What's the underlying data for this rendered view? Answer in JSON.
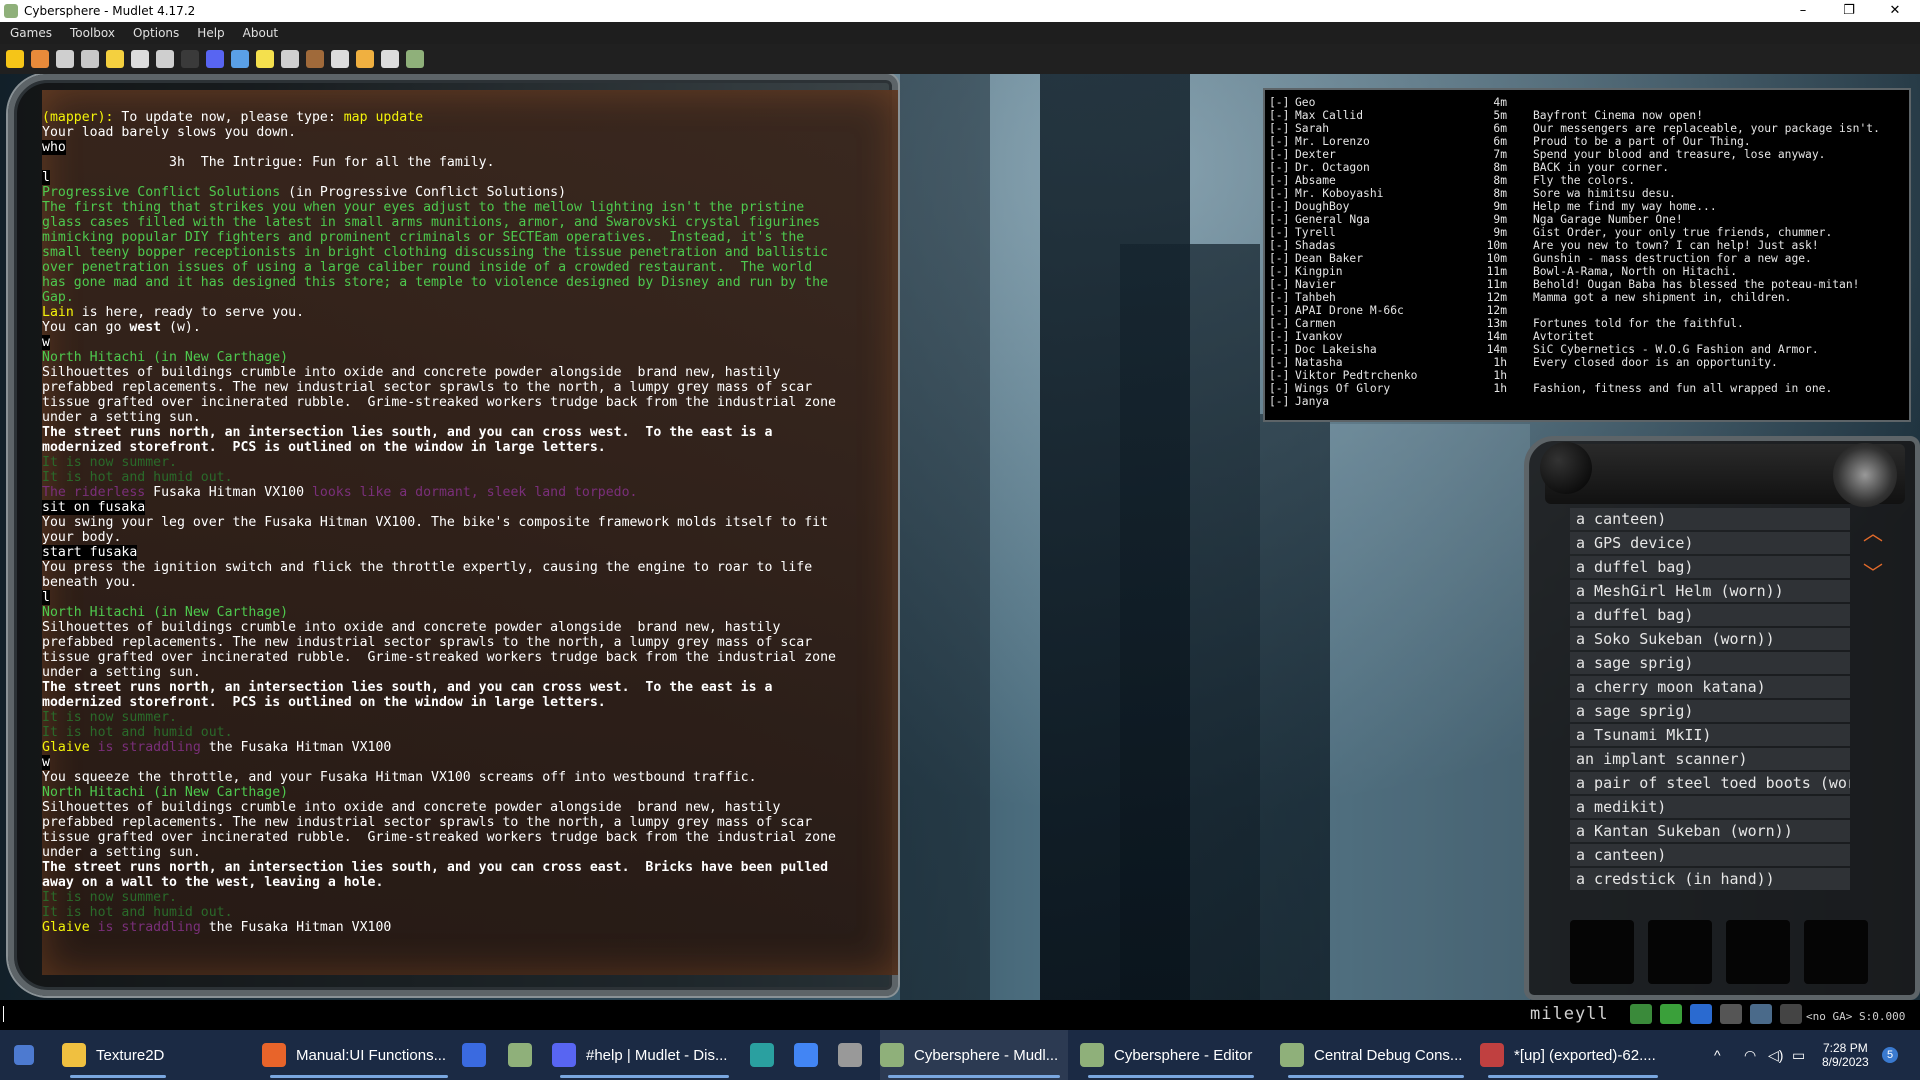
{
  "window": {
    "title": "Cybersphere - Mudlet 4.17.2",
    "controls": [
      "–",
      "❐",
      "✕"
    ]
  },
  "menu": [
    "Games",
    "Toolbox",
    "Options",
    "Help",
    "About"
  ],
  "toolbar": {
    "icons": [
      "connect-icon",
      "disconnect-icon",
      "reconnect-icon",
      "triggers-icon",
      "aliases-icon",
      "scripts-icon",
      "keys-icon",
      "variables-icon",
      "discord-icon",
      "map-icon",
      "notepad-icon",
      "packages-icon",
      "modules-icon",
      "replay-icon",
      "settings-icon",
      "fullscreen-icon",
      "mudlet-icon"
    ],
    "colors": [
      "#f5c518",
      "#e88a3a",
      "#cfcfcf",
      "#c8c8c8",
      "#f4d03f",
      "#dcdcdc",
      "#cfcfcf",
      "#3a3a3a",
      "#5865f2",
      "#5aa0e6",
      "#f4e04d",
      "#cfcfcf",
      "#a06a3a",
      "#dcdcdc",
      "#f0b040",
      "#dcdcdc",
      "#8fb07a"
    ]
  },
  "console": {
    "lines": [
      {
        "parts": [
          [
            "y",
            "(mapper): "
          ],
          [
            "w",
            "To update now, please type: "
          ],
          [
            "y",
            "map update"
          ]
        ]
      },
      {
        "parts": [
          [
            "w",
            "Your load barely slows you down."
          ]
        ]
      },
      {
        "parts": [
          [
            "cmd",
            "who"
          ]
        ]
      },
      {
        "parts": [
          [
            "w",
            "                3h  The Intrigue: Fun for all the family."
          ]
        ]
      },
      {
        "parts": [
          [
            "cmd",
            "l"
          ]
        ]
      },
      {
        "parts": [
          [
            "g",
            "Progressive Conflict Solutions"
          ],
          [
            "w",
            " (in Progressive Conflict Solutions)"
          ]
        ]
      },
      {
        "parts": [
          [
            "g",
            "The first thing that strikes you when your eyes adjust to the mellow lighting isn't the pristine"
          ]
        ]
      },
      {
        "parts": [
          [
            "g",
            "glass cases filled with the latest in small arms munitions, armor, and Swarovski crystal figurines"
          ]
        ]
      },
      {
        "parts": [
          [
            "g",
            "mimicking popular DIY fighters and prominent criminals or SECTEam operatives.  Instead, it's the"
          ]
        ]
      },
      {
        "parts": [
          [
            "g",
            "small teeny bopper receptionists in bright clothing discussing the tissue penetration and ballistic"
          ]
        ]
      },
      {
        "parts": [
          [
            "g",
            "over penetration issues of using a large caliber round inside of a crowded restaurant.  The world"
          ]
        ]
      },
      {
        "parts": [
          [
            "g",
            "has gone mad and it has designed this store; a temple to violence designed by Disney and run by the"
          ]
        ]
      },
      {
        "parts": [
          [
            "g",
            "Gap."
          ]
        ]
      },
      {
        "parts": [
          [
            "y",
            "Lain"
          ],
          [
            "w",
            " is here, ready to serve you."
          ]
        ]
      },
      {
        "parts": [
          [
            "w",
            "You can go "
          ],
          [
            "b",
            "west"
          ],
          [
            "w",
            " (w)."
          ]
        ]
      },
      {
        "parts": [
          [
            "cmd",
            "w"
          ]
        ]
      },
      {
        "parts": [
          [
            "g",
            "North Hitachi (in New Carthage)"
          ]
        ]
      },
      {
        "parts": [
          [
            "w",
            "Silhouettes of buildings crumble into oxide and concrete powder alongside  brand new, hastily"
          ]
        ]
      },
      {
        "parts": [
          [
            "w",
            "prefabbed replacements. The new industrial sector sprawls to the north, a lumpy grey mass of scar"
          ]
        ]
      },
      {
        "parts": [
          [
            "w",
            "tissue grafted over incinerated rubble.  Grime-streaked workers trudge back from the industrial zone"
          ]
        ]
      },
      {
        "parts": [
          [
            "w",
            "under a setting sun."
          ]
        ]
      },
      {
        "parts": [
          [
            "b",
            "The street runs north, an intersection lies south, and you can cross west.  To the east is a"
          ]
        ]
      },
      {
        "parts": [
          [
            "b",
            "modernized storefront.  PCS is outlined on the window in large letters."
          ]
        ]
      },
      {
        "parts": [
          [
            "dg",
            "It is now summer."
          ]
        ]
      },
      {
        "parts": [
          [
            "dg",
            "It is hot and humid out."
          ]
        ]
      },
      {
        "parts": [
          [
            "pp",
            "The riderless "
          ],
          [
            "w",
            "Fusaka Hitman VX100"
          ],
          [
            "pp",
            " looks like a dormant, sleek land torpedo."
          ]
        ]
      },
      {
        "parts": [
          [
            "cmd",
            "sit on fusaka"
          ]
        ]
      },
      {
        "parts": [
          [
            "w",
            "You swing your leg over the Fusaka Hitman VX100. The bike's composite framework molds itself to fit"
          ]
        ]
      },
      {
        "parts": [
          [
            "w",
            "your body."
          ]
        ]
      },
      {
        "parts": [
          [
            "cmd",
            "start fusaka"
          ]
        ]
      },
      {
        "parts": [
          [
            "w",
            "You press the ignition switch and flick the throttle expertly, causing the engine to roar to life"
          ]
        ]
      },
      {
        "parts": [
          [
            "w",
            "beneath you."
          ]
        ]
      },
      {
        "parts": [
          [
            "cmd",
            "l"
          ]
        ]
      },
      {
        "parts": [
          [
            "g",
            "North Hitachi (in New Carthage)"
          ]
        ]
      },
      {
        "parts": [
          [
            "w",
            "Silhouettes of buildings crumble into oxide and concrete powder alongside  brand new, hastily"
          ]
        ]
      },
      {
        "parts": [
          [
            "w",
            "prefabbed replacements. The new industrial sector sprawls to the north, a lumpy grey mass of scar"
          ]
        ]
      },
      {
        "parts": [
          [
            "w",
            "tissue grafted over incinerated rubble.  Grime-streaked workers trudge back from the industrial zone"
          ]
        ]
      },
      {
        "parts": [
          [
            "w",
            "under a setting sun."
          ]
        ]
      },
      {
        "parts": [
          [
            "b",
            "The street runs north, an intersection lies south, and you can cross west.  To the east is a"
          ]
        ]
      },
      {
        "parts": [
          [
            "b",
            "modernized storefront.  PCS is outlined on the window in large letters."
          ]
        ]
      },
      {
        "parts": [
          [
            "dg",
            "It is now summer."
          ]
        ]
      },
      {
        "parts": [
          [
            "dg",
            "It is hot and humid out."
          ]
        ]
      },
      {
        "parts": [
          [
            "y",
            "Glaive"
          ],
          [
            "pp",
            " is straddling "
          ],
          [
            "w",
            "the Fusaka Hitman VX100"
          ]
        ]
      },
      {
        "parts": [
          [
            "cmd",
            "w"
          ]
        ]
      },
      {
        "parts": [
          [
            "w",
            "You squeeze the throttle, and your Fusaka Hitman VX100 screams off into westbound traffic."
          ]
        ]
      },
      {
        "parts": [
          [
            "g",
            "North Hitachi (in New Carthage)"
          ]
        ]
      },
      {
        "parts": [
          [
            "w",
            "Silhouettes of buildings crumble into oxide and concrete powder alongside  brand new, hastily"
          ]
        ]
      },
      {
        "parts": [
          [
            "w",
            "prefabbed replacements. The new industrial sector sprawls to the north, a lumpy grey mass of scar"
          ]
        ]
      },
      {
        "parts": [
          [
            "w",
            "tissue grafted over incinerated rubble.  Grime-streaked workers trudge back from the industrial zone"
          ]
        ]
      },
      {
        "parts": [
          [
            "w",
            "under a setting sun."
          ]
        ]
      },
      {
        "parts": [
          [
            "b",
            "The street runs north, an intersection lies south, and you can cross east.  Bricks have been pulled"
          ]
        ]
      },
      {
        "parts": [
          [
            "b",
            "away on a wall to the west, leaving a hole."
          ]
        ]
      },
      {
        "parts": [
          [
            "dg",
            "It is now summer."
          ]
        ]
      },
      {
        "parts": [
          [
            "dg",
            "It is hot and humid out."
          ]
        ]
      },
      {
        "parts": [
          [
            "y",
            "Glaive"
          ],
          [
            "pp",
            " is straddling "
          ],
          [
            "w",
            "the Fusaka Hitman VX100"
          ]
        ]
      }
    ]
  },
  "who_list": [
    {
      "tag": "[-]",
      "name": "Geo",
      "idle": "4m",
      "msg": ""
    },
    {
      "tag": "[-]",
      "name": "Max Callid",
      "idle": "5m",
      "msg": "Bayfront Cinema now open!"
    },
    {
      "tag": "[-]",
      "name": "Sarah",
      "idle": "6m",
      "msg": "Our messengers are replaceable, your package isn't."
    },
    {
      "tag": "[-]",
      "name": "Mr. Lorenzo",
      "idle": "6m",
      "msg": "Proud to be a part of Our Thing."
    },
    {
      "tag": "[-]",
      "name": "Dexter",
      "idle": "7m",
      "msg": "Spend your blood and treasure, lose anyway."
    },
    {
      "tag": "[-]",
      "name": "Dr. Octagon",
      "idle": "8m",
      "msg": "BACK in your corner."
    },
    {
      "tag": "[-]",
      "name": "Absame",
      "idle": "8m",
      "msg": "Fly the colors."
    },
    {
      "tag": "[-]",
      "name": "Mr. Koboyashi",
      "idle": "8m",
      "msg": "Sore wa himitsu desu."
    },
    {
      "tag": "[-]",
      "name": "DoughBoy",
      "idle": "9m",
      "msg": "Help me find my way home..."
    },
    {
      "tag": "[-]",
      "name": "General Nga",
      "idle": "9m",
      "msg": "Nga Garage Number One!"
    },
    {
      "tag": "[-]",
      "name": "Tyrell",
      "idle": "9m",
      "msg": "Gist Order, your only true friends, chummer."
    },
    {
      "tag": "[-]",
      "name": "Shadas",
      "idle": "10m",
      "msg": "Are you new to town? I can help! Just ask!"
    },
    {
      "tag": "[-]",
      "name": "Dean Baker",
      "idle": "10m",
      "msg": "Gunshin - mass destruction for a new age."
    },
    {
      "tag": "[-]",
      "name": "Kingpin",
      "idle": "11m",
      "msg": "Bowl-A-Rama, North on Hitachi."
    },
    {
      "tag": "[-]",
      "name": "Navier",
      "idle": "11m",
      "msg": "Behold! Ougan Baba has blessed the poteau-mitan!"
    },
    {
      "tag": "[-]",
      "name": "Tahbeh",
      "idle": "12m",
      "msg": "Mamma got a new shipment in, children."
    },
    {
      "tag": "[-]",
      "name": "APAI Drone M-66c",
      "idle": "12m",
      "msg": ""
    },
    {
      "tag": "[-]",
      "name": "Carmen",
      "idle": "13m",
      "msg": "Fortunes told for the faithful."
    },
    {
      "tag": "[-]",
      "name": "Ivankov",
      "idle": "14m",
      "msg": "Avtoritet"
    },
    {
      "tag": "[-]",
      "name": "Doc Lakeisha",
      "idle": "14m",
      "msg": "SiC Cybernetics - W.O.G Fashion and Armor."
    },
    {
      "tag": "[-]",
      "name": "Natasha",
      "idle": "1h",
      "msg": "Every closed door is an opportunity."
    },
    {
      "tag": "[-]",
      "name": "Viktor Pedtrchenko",
      "idle": "1h",
      "msg": ""
    },
    {
      "tag": "[-]",
      "name": "Wings Of Glory",
      "idle": "1h",
      "msg": "Fashion, fitness and fun all wrapped in one."
    },
    {
      "tag": "[-]",
      "name": "Janya",
      "idle": "",
      "msg": ""
    }
  ],
  "inventory": {
    "items": [
      "a canteen)",
      "a GPS device)",
      "a duffel bag)",
      "a MeshGirl Helm (worn))",
      "a duffel bag)",
      "a Soko Sukeban (worn))",
      "a sage sprig)",
      "a cherry moon katana)",
      "a sage sprig)",
      "a Tsunami MkII)",
      "an implant scanner)",
      "a pair of steel toed boots (wor",
      "a medikit)",
      "a Kantan Sukeban (worn))",
      "a canteen)",
      "a credstick (in hand))"
    ],
    "scroll_up": "︿",
    "scroll_down": "﹀"
  },
  "statusbar": {
    "logo": "mileyll",
    "status": "<no GA> S:0.000",
    "button_icons": [
      "green-arrow-icon",
      "lightning-icon",
      "info-icon",
      "keyboard-icon",
      "monitor-icon",
      "record-icon"
    ],
    "button_colors": [
      "#3a8a3a",
      "#3aa03a",
      "#2a6ad0",
      "#555",
      "#4a6a8a",
      "#444"
    ]
  },
  "taskbar": {
    "items": [
      {
        "label": "Texture2D",
        "icon": "folder-icon",
        "color": "#f0c040"
      },
      {
        "label": "Manual:UI Functions...",
        "icon": "firefox-icon",
        "color": "#e8642a"
      },
      {
        "label": "",
        "icon": "app-icon",
        "color": "#3a6ae0"
      },
      {
        "label": "",
        "icon": "mudlet-icon",
        "color": "#8fb07a"
      },
      {
        "label": "#help | Mudlet - Dis...",
        "icon": "discord-icon",
        "color": "#5865f2"
      },
      {
        "label": "",
        "icon": "terminal-icon",
        "color": "#2aa0a0"
      },
      {
        "label": "",
        "icon": "chrome-icon",
        "color": "#4285f4"
      },
      {
        "label": "",
        "icon": "calculator-icon",
        "color": "#999"
      },
      {
        "label": "Cybersphere - Mudl...",
        "icon": "mudlet-icon",
        "color": "#8fb07a"
      },
      {
        "label": "Cybersphere - Editor",
        "icon": "mudlet-icon",
        "color": "#8fb07a"
      },
      {
        "label": "Central Debug Cons...",
        "icon": "mudlet-icon",
        "color": "#8fb07a"
      },
      {
        "label": "*[up] (exported)-62....",
        "icon": "paint-icon",
        "color": "#c04040"
      }
    ],
    "time": "7:28 PM",
    "date": "8/9/2023",
    "notification_count": "5"
  }
}
